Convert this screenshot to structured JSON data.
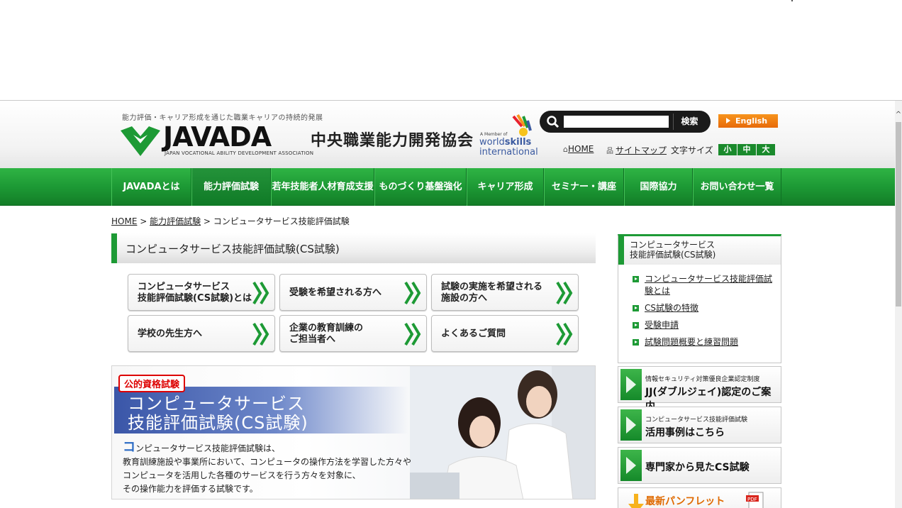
{
  "header": {
    "tagline": "能力評価・キャリア形成を通じた職業キャリアの持続的発展",
    "logo_word": "JAVADA",
    "logo_jp": "中央職業能力開発協会",
    "logo_en": "JAPAN VOCATIONAL ABILITY DEVELOPMENT ASSOCIATION",
    "worldskills_member": "A Member of",
    "worldskills_world": "world",
    "worldskills_skills": "skills",
    "worldskills_intl": "international",
    "search": {
      "placeholder": "",
      "button": "検索"
    },
    "english": "English",
    "util": {
      "home": "HOME",
      "sitemap": "サイトマップ",
      "fontsize_label": "文字サイズ",
      "fontsize": [
        "小",
        "中",
        "大"
      ]
    }
  },
  "nav": [
    {
      "label": "JAVADAとは",
      "active": false
    },
    {
      "label": "能力評価試験",
      "active": true
    },
    {
      "label": "若年技能者人材育成支援",
      "active": false
    },
    {
      "label": "ものづくり基盤強化",
      "active": false
    },
    {
      "label": "キャリア形成",
      "active": false
    },
    {
      "label": "セミナー・講座",
      "active": false
    },
    {
      "label": "国際協力",
      "active": false
    },
    {
      "label": "お問い合わせ一覧",
      "active": false
    }
  ],
  "breadcrumb": {
    "home": "HOME",
    "sep1": " > ",
    "level1": "能力評価試験",
    "sep2": " > ",
    "current": "コンピュータサービス技能評価試験"
  },
  "page_title": "コンピュータサービス技能評価試験(CS試験)",
  "buttons": [
    {
      "line1": "コンピュータサービス",
      "line2": "技能評価試験(CS試験)とは"
    },
    {
      "line1": "受験を希望される方へ",
      "line2": ""
    },
    {
      "line1": "試験の実施を希望される",
      "line2": "施設の方へ"
    },
    {
      "line1": "学校の先生方へ",
      "line2": ""
    },
    {
      "line1": "企業の教育訓練の",
      "line2": "ご担当者へ"
    },
    {
      "line1": "よくあるご質問",
      "line2": ""
    }
  ],
  "banner": {
    "badge": "公的資格試験",
    "title1": "コンピュータサービス",
    "title2": "技能評価試験(CS試験)",
    "cap": "コ",
    "text1": "ンピュータサービス技能評価試験は、",
    "text2": "教育訓練施設や事業所において、コンピュータの操作方法を学習した方々や",
    "text3": "コンピュータを活用した各種のサービスを行う方々を対象に、",
    "text4": "その操作能力を評価する試験です。"
  },
  "sidebar": {
    "head1": "コンピュータサービス",
    "head2": "技能評価試験(CS試験)",
    "links": [
      {
        "line1": "コンピュータサービス技能評価試",
        "line2": "験とは"
      },
      {
        "line1": "CS試験の特徴",
        "line2": ""
      },
      {
        "line1": "受験申請",
        "line2": ""
      },
      {
        "line1": "試験問題概要と練習問題",
        "line2": ""
      }
    ],
    "banners": [
      {
        "small": "情報セキュリティ対策優良企業認定制度",
        "big": "JJ(ダブルジェイ)認定のご案内"
      },
      {
        "small": "コンピュータサービス技能評価試験",
        "big": "活用事例はこちら"
      },
      {
        "single": "専門家から見たCS試験"
      },
      {
        "single": "最新パンフレット"
      }
    ]
  },
  "colors": {
    "green": "#1d9a35",
    "orange": "#f7941d",
    "blue": "#3a56a8"
  }
}
